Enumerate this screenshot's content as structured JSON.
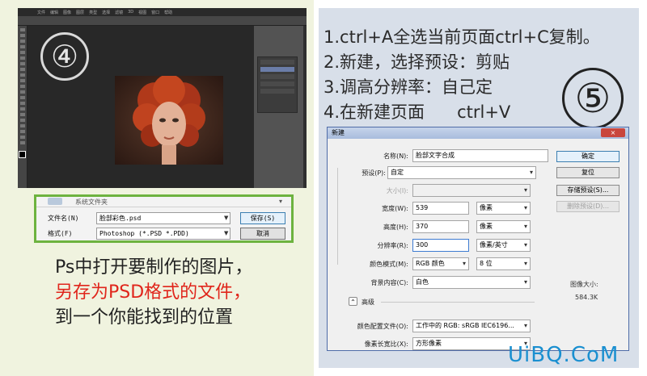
{
  "left": {
    "step_number": "④",
    "ps_menu": [
      "文件",
      "编辑",
      "图像",
      "图层",
      "类型",
      "选择",
      "滤镜",
      "3D",
      "视图",
      "窗口",
      "帮助"
    ],
    "save_dialog": {
      "folder_label": "系统文件夹",
      "filename_label": "文件名(N)",
      "filename_value": "脸部彩色.psd",
      "format_label": "格式(F)",
      "format_value": "Photoshop (*.PSD *.PDD)",
      "save_button": "保存(S)",
      "cancel_button": "取消"
    },
    "caption": {
      "line1": "Ps中打开要制作的图片，",
      "line2": "另存为PSD格式的文件，",
      "line3": "到一个你能找到的位置"
    }
  },
  "right": {
    "steps": [
      "1.ctrl+A全选当前页面ctrl+C复制。",
      "2.新建，选择预设：剪贴",
      "3.调高分辨率：自己定",
      "4.在新建页面      ctrl+V"
    ],
    "step_number": "⑤",
    "new_dialog": {
      "title": "新建",
      "close": "×",
      "name_label": "名称(N):",
      "name_value": "脸部文字合成",
      "preset_label": "预设(P):",
      "preset_value": "自定",
      "size_label": "大小(I):",
      "width_label": "宽度(W):",
      "width_value": "539",
      "width_unit": "像素",
      "height_label": "高度(H):",
      "height_value": "370",
      "height_unit": "像素",
      "resolution_label": "分辨率(R):",
      "resolution_value": "300",
      "resolution_unit": "像素/英寸",
      "color_mode_label": "颜色模式(M):",
      "color_mode_value": "RGB 颜色",
      "bit_depth": "8 位",
      "background_label": "背景内容(C):",
      "background_value": "白色",
      "advanced_label": "高级",
      "advanced_toggle": "⌃",
      "profile_label": "颜色配置文件(O):",
      "profile_value": "工作中的 RGB: sRGB IEC6196...",
      "pixel_aspect_label": "像素长宽比(X):",
      "pixel_aspect_value": "方形像素",
      "ok_button": "确定",
      "cancel_button": "复位",
      "save_preset_button": "存储预设(S)...",
      "delete_preset_button": "删除预设(D)...",
      "image_size_label": "图像大小:",
      "image_size_value": "584.3K"
    }
  },
  "watermark": "UiBQ.CoM",
  "colors": {
    "left_bg": "#f0f3df",
    "right_bg": "#d8dfe9",
    "accent_green": "#6db33f",
    "caption_red": "#e0251b",
    "watermark_blue": "#1a8fd0"
  }
}
